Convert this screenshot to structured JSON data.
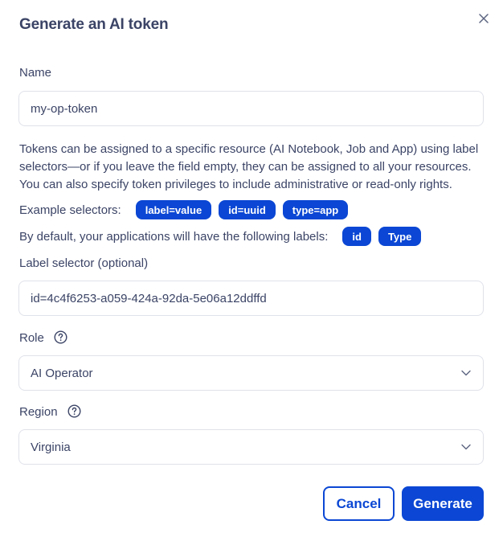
{
  "dialog": {
    "title": "Generate an AI token",
    "close_icon": "close-icon"
  },
  "name": {
    "label": "Name",
    "value": "my-op-token"
  },
  "description": "Tokens can be assigned to a specific resource (AI Notebook, Job and App) using label selectors—or if you leave the field empty, they can be assigned to all your resources. You can also specify token privileges to include administrative or read-only rights.",
  "example_selectors": {
    "lead": "Example selectors:",
    "chips": [
      "label=value",
      "id=uuid",
      "type=app"
    ]
  },
  "default_labels": {
    "lead": "By default, your applications will have the following labels:",
    "chips": [
      "id",
      "Type"
    ]
  },
  "label_selector": {
    "label": "Label selector (optional)",
    "value": "id=4c4f6253-a059-424a-92da-5e06a12ddffd"
  },
  "role": {
    "label": "Role",
    "value": "AI Operator",
    "help_icon": "question-circle-icon"
  },
  "region": {
    "label": "Region",
    "value": "Virginia",
    "help_icon": "question-circle-icon"
  },
  "actions": {
    "cancel": "Cancel",
    "generate": "Generate"
  },
  "colors": {
    "primary": "#0b47d4",
    "text": "#3b4466",
    "border": "#dfe2ea"
  }
}
